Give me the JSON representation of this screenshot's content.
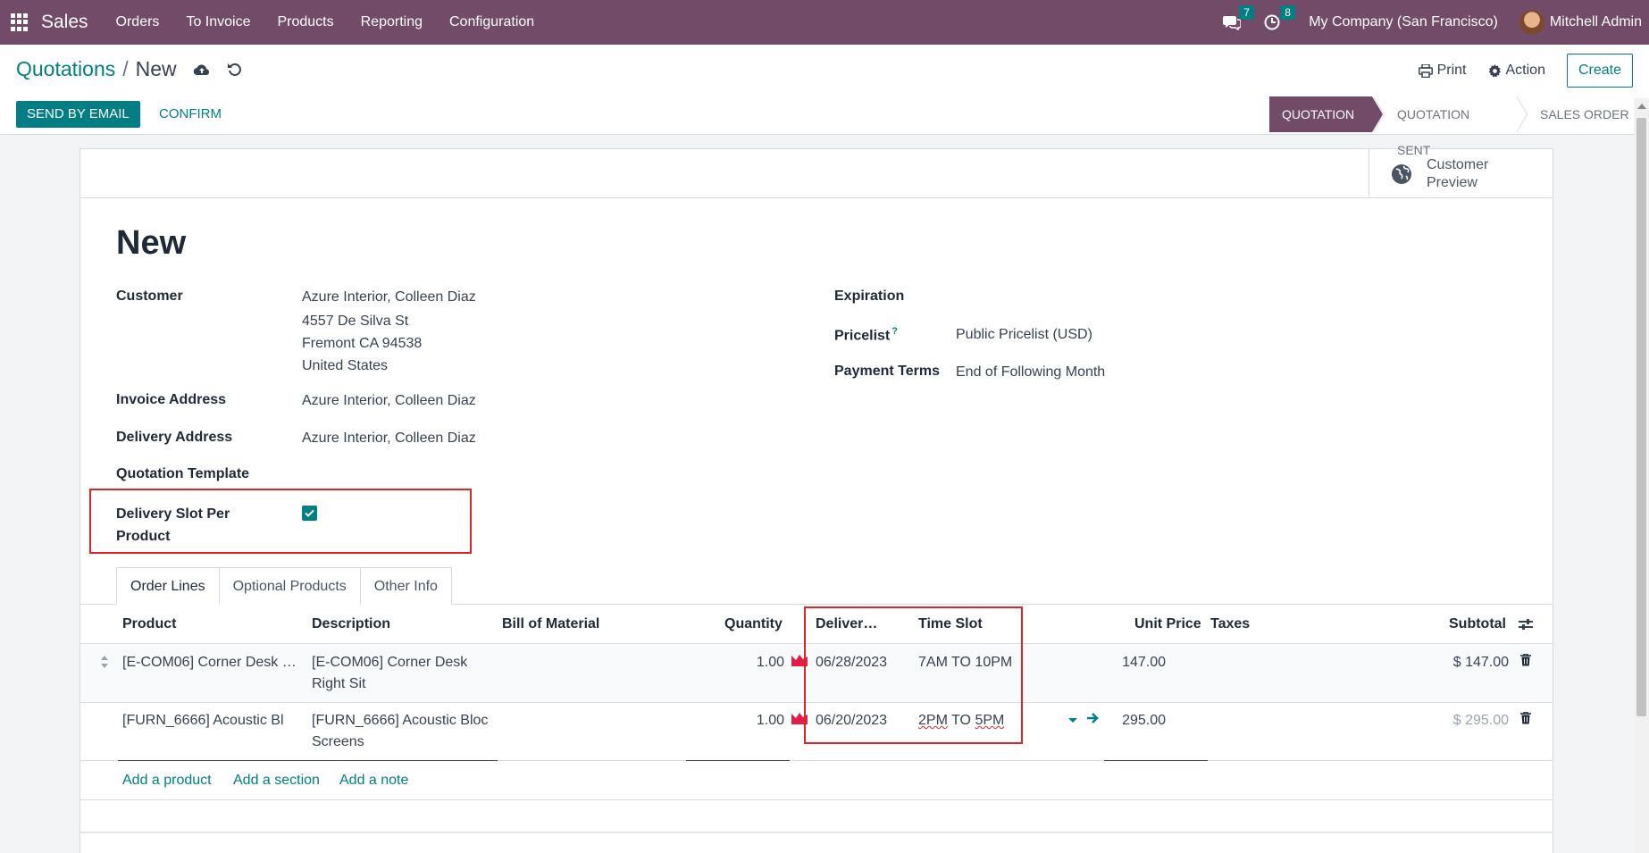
{
  "navbar": {
    "brand": "Sales",
    "menu": [
      "Orders",
      "To Invoice",
      "Products",
      "Reporting",
      "Configuration"
    ],
    "messages_count": "7",
    "activities_count": "8",
    "company": "My Company (San Francisco)",
    "user": "Mitchell Admin",
    "color": "#714B67"
  },
  "breadcrumb": {
    "parent": "Quotations",
    "separator": "/",
    "current": "New"
  },
  "toolbar": {
    "print": "Print",
    "action": "Action",
    "create": "Create"
  },
  "actions": {
    "send_by_email": "SEND BY EMAIL",
    "confirm": "CONFIRM"
  },
  "statusbar": {
    "stages": [
      "QUOTATION",
      "QUOTATION SENT",
      "SALES ORDER"
    ],
    "active": "QUOTATION"
  },
  "smart_buttons": {
    "customer_preview": "Customer Preview"
  },
  "form": {
    "title": "New",
    "customer_label": "Customer",
    "customer_name": "Azure Interior, Colleen Diaz",
    "customer_address": [
      "4557 De Silva St",
      "Fremont CA 94538",
      "United States"
    ],
    "invoice_address_label": "Invoice Address",
    "invoice_address": "Azure Interior, Colleen Diaz",
    "delivery_address_label": "Delivery Address",
    "delivery_address": "Azure Interior, Colleen Diaz",
    "quotation_template_label": "Quotation Template",
    "delivery_slot_label": "Delivery Slot Per Product",
    "delivery_slot_checked": true,
    "expiration_label": "Expiration",
    "pricelist_label": "Pricelist",
    "pricelist_help": "?",
    "pricelist": "Public Pricelist (USD)",
    "payment_terms_label": "Payment Terms",
    "payment_terms": "End of Following Month"
  },
  "tabs": [
    "Order Lines",
    "Optional Products",
    "Other Info"
  ],
  "order_lines": {
    "columns": [
      "Product",
      "Description",
      "Bill of Material",
      "Quantity",
      "Deliver…",
      "Time Slot",
      "Unit Price",
      "Taxes",
      "Subtotal"
    ],
    "rows": [
      {
        "product": "[E-COM06] Corner Desk …",
        "description": "[E-COM06] Corner Desk Right Sit",
        "quantity": "1.00",
        "delivery_date": "06/28/2023",
        "time_slot": "7AM TO 10PM",
        "unit_price": "147.00",
        "subtotal": "$ 147.00"
      },
      {
        "product": "[FURN_6666] Acoustic Bl",
        "description": "[FURN_6666] Acoustic Bloc Screens",
        "quantity": "1.00",
        "delivery_date": "06/20/2023",
        "time_slot_start": "2PM",
        "time_slot_mid": "TO",
        "time_slot_end": "5PM",
        "unit_price": "295.00",
        "subtotal": "$ 295.00"
      }
    ],
    "add_product": "Add a product",
    "add_section": "Add a section",
    "add_note": "Add a note"
  },
  "colors": {
    "accent": "#017e84",
    "highlight": "#e02424",
    "forecast_icon": "#e11d48"
  }
}
